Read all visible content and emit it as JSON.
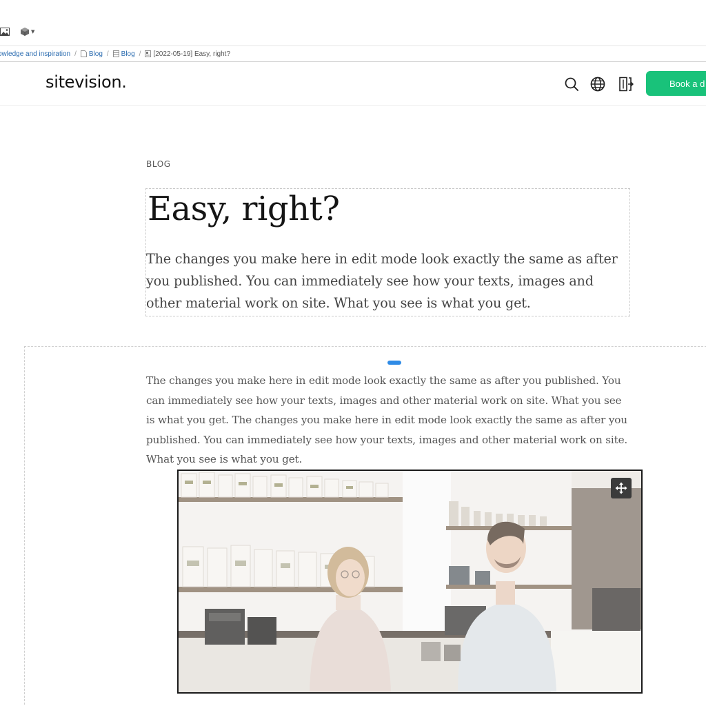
{
  "toolbar": {
    "icons": [
      "image-icon",
      "cube-icon"
    ]
  },
  "breadcrumb": {
    "items": [
      {
        "label": "owledge and inspiration",
        "icon": ""
      },
      {
        "label": "Blog",
        "icon": "page-icon"
      },
      {
        "label": "Blog",
        "icon": "archive-icon"
      },
      {
        "label": "[2022-05-19] Easy, right?",
        "icon": "article-icon"
      }
    ],
    "separator": "/"
  },
  "header": {
    "logo": "sitevision.",
    "icons": [
      "search-icon",
      "globe-icon",
      "login-icon"
    ],
    "cta_label": "Book a d"
  },
  "article": {
    "category": "BLOG",
    "title": "Easy, right?",
    "lead": "The changes you make here in edit mode look exactly the same as after you published. You can immediately see how your texts, images and other material work on site. What you see is what you get.",
    "body": "The changes you make here in edit mode look exactly the same as after you published. You can immediately see how your texts, images and other material work on site. What you see is what you get. The changes you make here in edit mode look exactly the same as after you published. You can immediately see how your texts, images and other material work on site. What you see is what you get."
  },
  "colors": {
    "accent": "#19c27a",
    "link": "#2b6cb0",
    "handle": "#2f8be6"
  }
}
